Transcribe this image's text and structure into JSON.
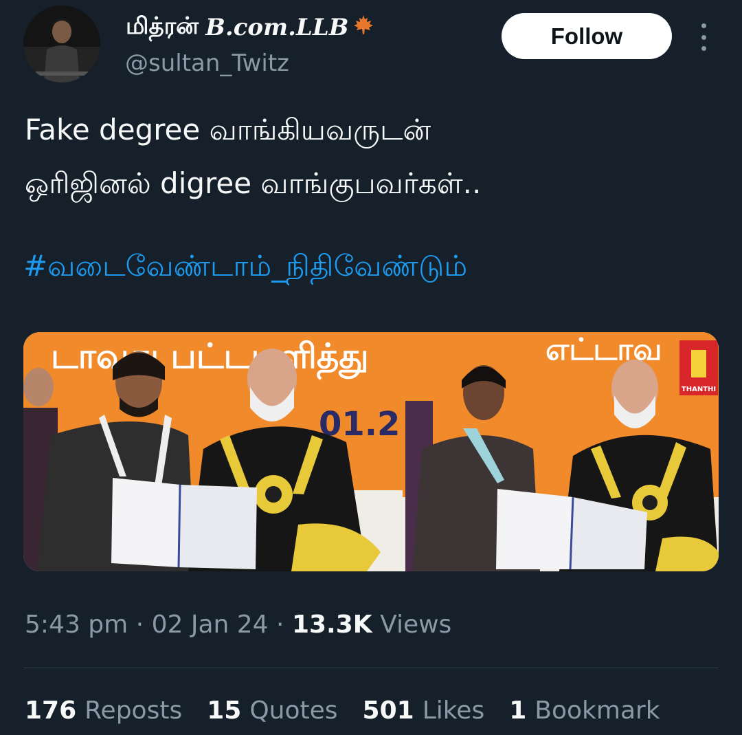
{
  "user": {
    "name_tamil": "மித்ரன்",
    "name_latin": "B.com.LLB",
    "handle": "@sultan_Twitz",
    "follow_label": "Follow"
  },
  "tweet": {
    "line1": "Fake degree வாங்கியவருடன்",
    "line2": "ஒரிஜினல் digree வாங்குபவர்கள்..",
    "hashtag": "#வடைவேண்டாம்_நிதிவேண்டும்"
  },
  "media": {
    "left_banner_text": "டாவது பட்டமளித்து",
    "left_date_text": "01.2",
    "right_banner_text": "எட்டாவ",
    "logo_text": "THANTHI"
  },
  "meta": {
    "time": "5:43 pm",
    "date": "02 Jan 24",
    "views_count": "13.3K",
    "views_label": "Views",
    "separator": "·"
  },
  "stats": {
    "reposts_count": "176",
    "reposts_label": "Reposts",
    "quotes_count": "15",
    "quotes_label": "Quotes",
    "likes_count": "501",
    "likes_label": "Likes",
    "bookmarks_count": "1",
    "bookmarks_label": "Bookmark"
  },
  "colors": {
    "background": "#15202b",
    "accent": "#1d9bf0",
    "secondary_text": "#8b98a5"
  }
}
